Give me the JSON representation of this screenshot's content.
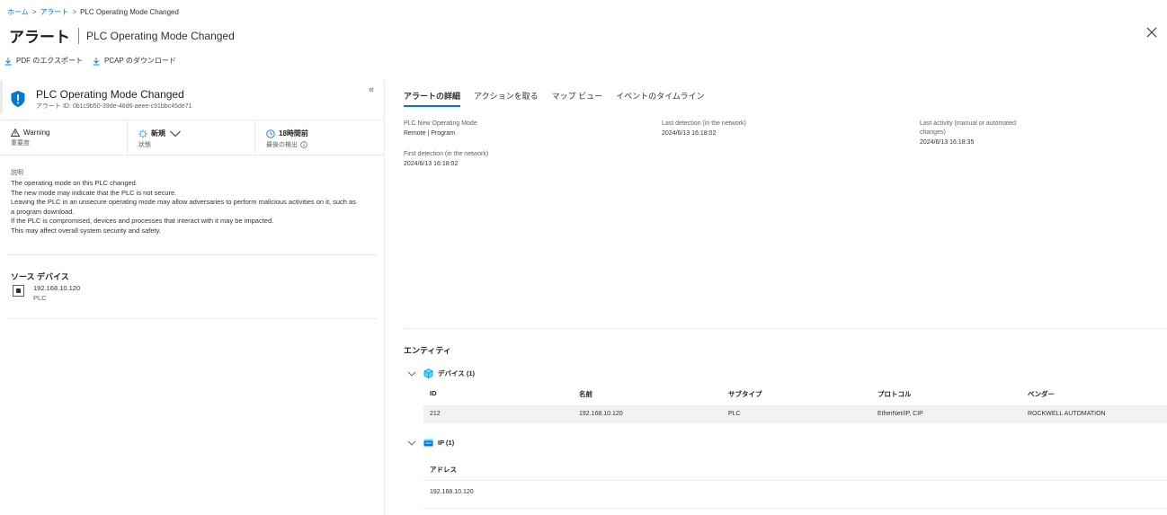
{
  "breadcrumb": {
    "home": "ホーム",
    "alerts": "アラート",
    "current": "PLC Operating Mode Changed"
  },
  "header": {
    "title": "アラート",
    "subtitle": "PLC Operating Mode Changed"
  },
  "toolbar": {
    "export_pdf": "PDF のエクスポート",
    "download_pcap": "PCAP のダウンロード"
  },
  "alert": {
    "name": "PLC Operating Mode Changed",
    "id_text": "アラート ID: 0b1c9b50-39de-48d6-aeee-c91bbc45de71",
    "severity_value": "Warning",
    "severity_label": "重要度",
    "status_value": "新規",
    "status_label": "状態",
    "time_value": "18時間前",
    "time_label": "最後の検出",
    "description_label": "説明",
    "description_lines": [
      "The operating mode on this PLC changed.",
      "The new mode may indicate that the PLC is not secure.",
      "Leaving the PLC in an unsecure operating mode may allow adversaries to perform malicious activities on it, such as",
      "a program download.",
      "If the PLC is compromised, devices and processes that interact with it may be impacted.",
      "This may affect overall system security and safety."
    ]
  },
  "source": {
    "title": "ソース デバイス",
    "ip": "192.168.10.120",
    "type": "PLC"
  },
  "tabs": [
    "アラートの詳細",
    "アクションを取る",
    "マップ ビュー",
    "イベントのタイムライン"
  ],
  "details": {
    "new_mode_label": "PLC New Operating Mode",
    "new_mode_value": "Remote | Program",
    "last_detection_label": "Last detection (in the network)",
    "last_detection_value": "2024/6/13 16:18:02",
    "last_activity_label_1": "Last activity (manual or automated",
    "last_activity_label_2": "changes)",
    "last_activity_value": "2024/6/13 16:18:35",
    "first_detection_label": "First detection (in the network)",
    "first_detection_value": "2024/6/13 16:18:02"
  },
  "entities": {
    "title": "エンティティ",
    "devices_header": "デバイス (1)",
    "columns": [
      "ID",
      "名前",
      "サブタイプ",
      "プロトコル",
      "ベンダー"
    ],
    "row": [
      "212",
      "192.168.10.120",
      "PLC",
      "EtherNet/IP, CIP",
      "ROCKWELL AUTOMATION"
    ],
    "ip_header": "IP (1)",
    "ip_column": "アドレス",
    "ip_value": "192.168.10.120"
  },
  "colors": {
    "accent": "#0078d4",
    "text": "#323130",
    "muted": "#605e5c",
    "border": "#edebe9"
  }
}
